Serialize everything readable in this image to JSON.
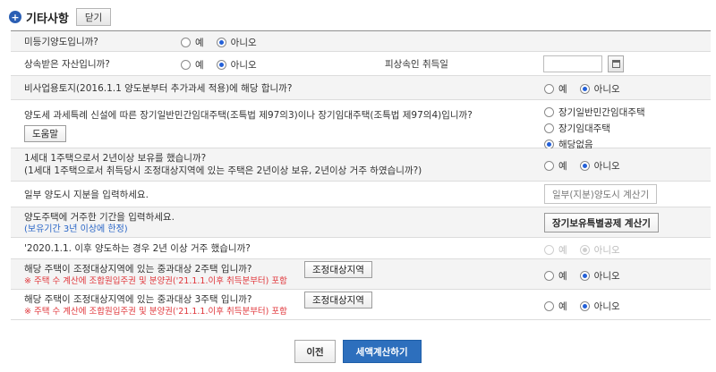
{
  "section": {
    "title": "기타사항",
    "close_label": "닫기"
  },
  "radio": {
    "yes": "예",
    "no": "아니오"
  },
  "rows": {
    "r1": {
      "q": "미등기양도입니까?"
    },
    "r2": {
      "q": "상속받은 자산입니까?",
      "date_label": "피상속인 취득일"
    },
    "r3": {
      "q": "비사업용토지(2016.1.1 양도분부터 추가과세 적용)에 해당 합니까?"
    },
    "r4": {
      "q": "양도세 과세특례 신설에 따른 장기일반민간임대주택(조특법 제97의3)이나 장기임대주택(조특법 제97의4)입니까?",
      "help": "도움말",
      "options": [
        "장기일반민간임대주택",
        "장기임대주택",
        "해당없음"
      ]
    },
    "r5": {
      "q1": "1세대 1주택으로서 2년이상 보유를 했습니까?",
      "q2": "(1세대 1주택으로서 취득당시 조정대상지역에 있는 주택은 2년이상 보유, 2년이상 거주 하였습니까?)"
    },
    "r6": {
      "q": "일부 양도시 지분을 입력하세요.",
      "btn": "일부(지분)양도시 계산기"
    },
    "r7": {
      "q": "양도주택에 거주한 기간을 입력하세요.",
      "sub": "(보유기간 3년 이상에 한정)",
      "btn": "장기보유특별공제 계산기"
    },
    "r8": {
      "q": "'2020.1.1. 이후 양도하는 경우 2년 이상 거주 했습니까?"
    },
    "r9": {
      "q": "해당 주택이 조정대상지역에 있는 중과대상 2주택 입니까?",
      "btn": "조정대상지역",
      "warn": "※ 주택 수 계산에 조합원입주권 및 분양권('21.1.1.이후 취득분부터) 포함"
    },
    "r10": {
      "q": "해당 주택이 조정대상지역에 있는 중과대상 3주택 입니까?",
      "btn": "조정대상지역",
      "warn": "※ 주택 수 계산에 조합원입주권 및 분양권('21.1.1.이후 취득분부터) 포함"
    }
  },
  "footer": {
    "prev": "이전",
    "next": "세액계산하기"
  }
}
